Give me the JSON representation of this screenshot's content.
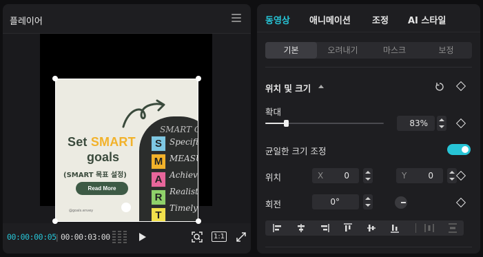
{
  "player": {
    "title": "플레이어",
    "current_time": "00:00:00:05",
    "total_time": "00:00:03:00",
    "ratio_label": "1:1"
  },
  "preview": {
    "title_part1": "Set ",
    "title_highlight": "SMART",
    "title_part2": "goals",
    "subtitle": "(SMART 목표 설정)",
    "button": "Read More",
    "handle": "@goals.envey",
    "board_top": "SMART G",
    "letters": [
      {
        "char": "S",
        "color": "#7ec8e3",
        "word": "Specific"
      },
      {
        "char": "M",
        "color": "#f2b22a",
        "word": "MEASURE"
      },
      {
        "char": "A",
        "color": "#e8669b",
        "word": "Achievable"
      },
      {
        "char": "R",
        "color": "#8fd16a",
        "word": "Realistic"
      },
      {
        "char": "T",
        "color": "#f2e14c",
        "word": "Timely"
      }
    ]
  },
  "props": {
    "tabs": [
      "동영상",
      "애니메이션",
      "조정",
      "AI 스타일"
    ],
    "active_tab": 0,
    "subtabs": [
      "기본",
      "오려내기",
      "마스크",
      "보정"
    ],
    "active_subtab": 0,
    "section_title": "위치 및 크기",
    "scale_label": "확대",
    "scale_value": "83%",
    "scale_level": 0.83,
    "uniform_label": "균일한 크기 조정",
    "uniform_on": true,
    "position_label": "위치",
    "x_prefix": "X",
    "x_value": "0",
    "y_prefix": "Y",
    "y_value": "0",
    "rotation_label": "회전",
    "rotation_value": "0°"
  },
  "colors": {
    "accent": "#27c4d6",
    "panel": "#1e1e21",
    "background": "#0f0f11"
  }
}
